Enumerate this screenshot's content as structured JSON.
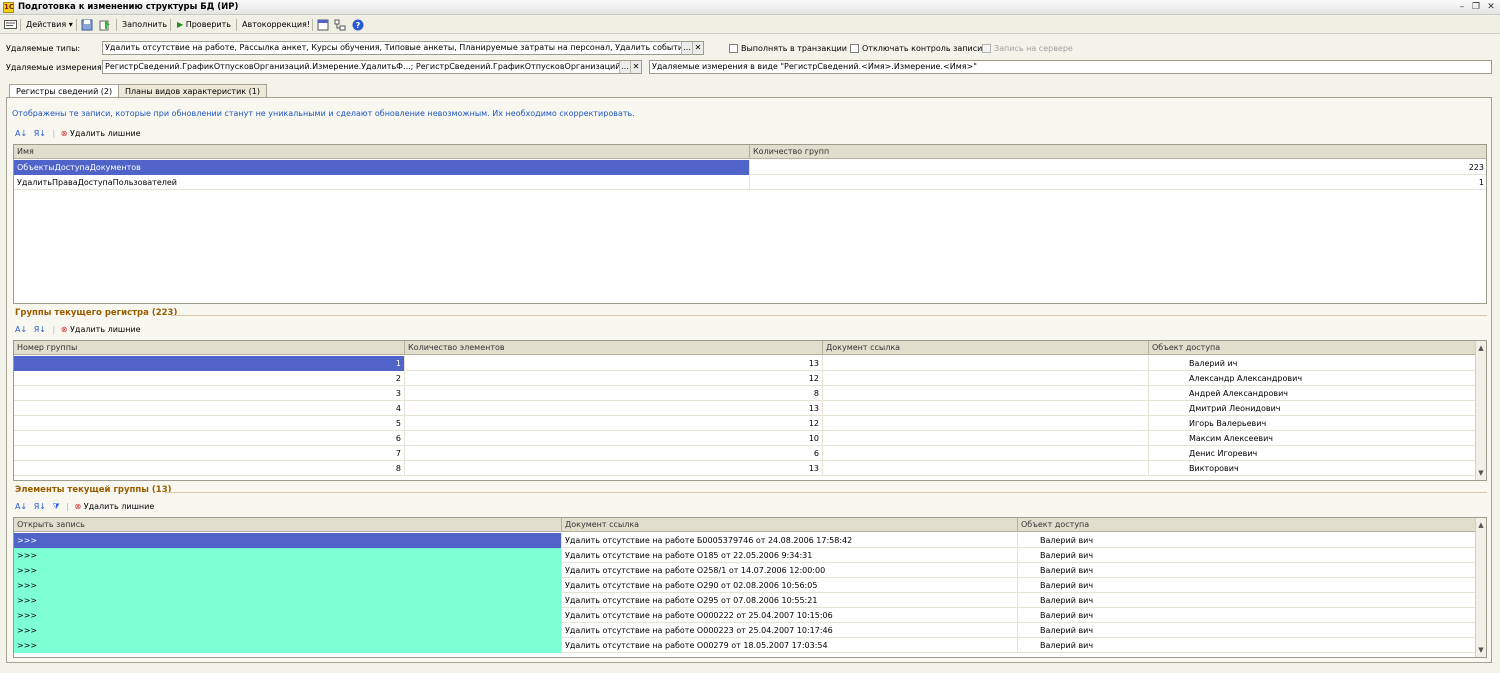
{
  "window": {
    "title": "Подготовка к изменению структуры БД (ИР)"
  },
  "toolbar": {
    "actions": "Действия",
    "fill": "Заполнить",
    "check": "Проверить",
    "autocorrect": "Автокоррекция!"
  },
  "form": {
    "types_label": "Удаляемые типы:",
    "types_value": "Удалить отсутствие на работе, Рассылка анкет, Курсы обучения, Типовые анкеты, Планируемые затраты на персонал, Удалить событие, Ввод",
    "in_transaction": "Выполнять в транзакции",
    "disable_write_control": "Отключать контроль записи",
    "server_write": "Запись на сервере",
    "dims_label": "Удаляемые измерения:",
    "dims_value": "РегистрСведений.ГрафикОтпусковОрганизаций.Измерение.УдалитьФ...; РегистрСведений.ГрафикОтпусковОрганизаций.Изме",
    "dims_hint": "Удаляемые измерения в виде \"РегистрСведений.<Имя>.Измерение.<Имя>\""
  },
  "tabs": [
    {
      "label": "Регистры сведений (2)"
    },
    {
      "label": "Планы видов характеристик (1)"
    }
  ],
  "info_text": "Отображены те записи, которые при обновлении станут не уникальными и сделают обновление невозможным. Их необходимо скорректировать.",
  "delete_extra": "Удалить лишние",
  "registers": {
    "columns": [
      "Имя",
      "Количество групп"
    ],
    "rows": [
      {
        "name": "ОбъектыДоступаДокументов",
        "count": "223"
      },
      {
        "name": "УдалитьПраваДоступаПользователей",
        "count": "1"
      }
    ]
  },
  "groups": {
    "title": "Группы текущего регистра (223)",
    "columns": [
      "Номер группы",
      "Количество элементов",
      "Документ ссылка",
      "Объект доступа"
    ],
    "rows": [
      {
        "num": "1",
        "count": "13",
        "doc": "",
        "obj": "Валерий          ич"
      },
      {
        "num": "2",
        "count": "12",
        "doc": "",
        "obj": "Александр Александрович"
      },
      {
        "num": "3",
        "count": "8",
        "doc": "",
        "obj": "Андрей Александрович"
      },
      {
        "num": "4",
        "count": "13",
        "doc": "",
        "obj": "Дмитрий Леонидович"
      },
      {
        "num": "5",
        "count": "12",
        "doc": "",
        "obj": "Игорь Валерьевич"
      },
      {
        "num": "6",
        "count": "10",
        "doc": "",
        "obj": "Максим Алексеевич"
      },
      {
        "num": "7",
        "count": "6",
        "doc": "",
        "obj": "Денис Игоревич"
      },
      {
        "num": "8",
        "count": "13",
        "doc": "",
        "obj": "Викторович"
      }
    ]
  },
  "elements": {
    "title": "Элементы текущей группы (13)",
    "columns": [
      "Открыть запись",
      "Документ ссылка",
      "Объект доступа"
    ],
    "rows": [
      {
        "open": ">>>",
        "doc": "Удалить отсутствие на работе Б0005379746 от 24.08.2006 17:58:42",
        "obj": "Валерий          вич"
      },
      {
        "open": ">>>",
        "doc": "Удалить отсутствие на работе О185 от 22.05.2006 9:34:31",
        "obj": "Валерий          вич"
      },
      {
        "open": ">>>",
        "doc": "Удалить отсутствие на работе О258/1 от 14.07.2006 12:00:00",
        "obj": "Валерий          вич"
      },
      {
        "open": ">>>",
        "doc": "Удалить отсутствие на работе О290 от 02.08.2006 10:56:05",
        "obj": "Валерий          вич"
      },
      {
        "open": ">>>",
        "doc": "Удалить отсутствие на работе О295 от 07.08.2006 10:55:21",
        "obj": "Валерий          вич"
      },
      {
        "open": ">>>",
        "doc": "Удалить отсутствие на работе О000222 от 25.04.2007 10:15:06",
        "obj": "Валерий          вич"
      },
      {
        "open": ">>>",
        "doc": "Удалить отсутствие на работе О000223 от 25.04.2007 10:17:46",
        "obj": "Валерий          вич"
      },
      {
        "open": ">>>",
        "doc": "Удалить отсутствие на работе О00279 от 18.05.2007 17:03:54",
        "obj": "Валерий          вич"
      }
    ]
  }
}
